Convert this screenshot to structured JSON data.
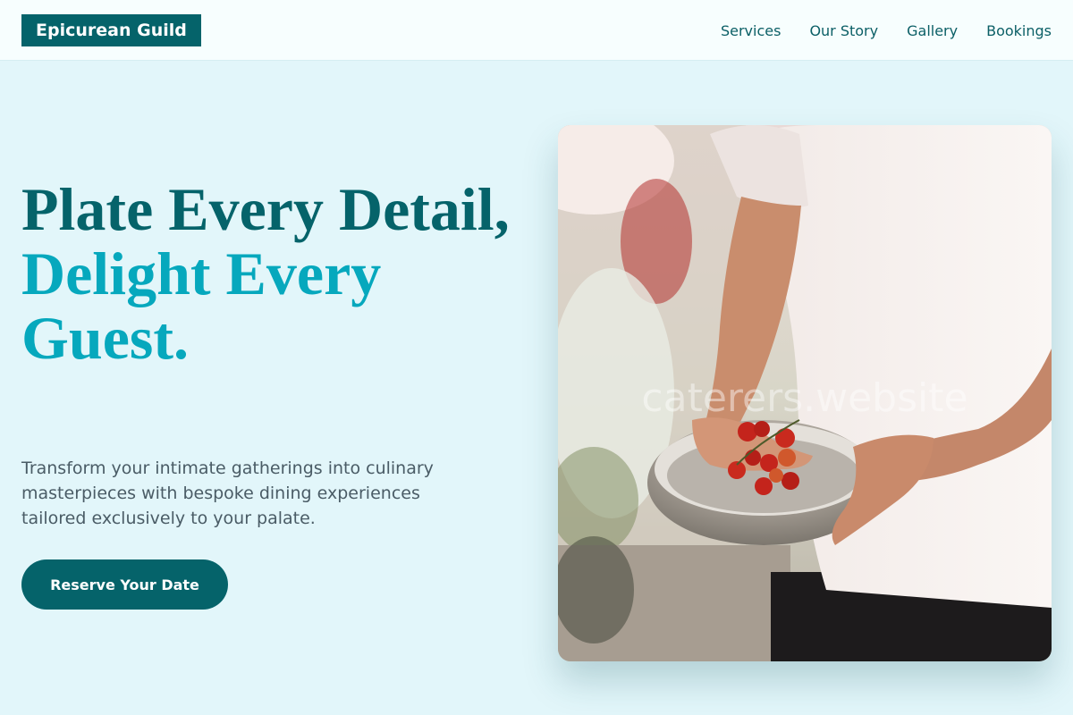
{
  "brand": {
    "name": "Epicurean Guild"
  },
  "nav": {
    "items": [
      {
        "label": "Services"
      },
      {
        "label": "Our Story"
      },
      {
        "label": "Gallery"
      },
      {
        "label": "Bookings"
      }
    ]
  },
  "hero": {
    "title_line1": "Plate Every Detail,",
    "title_line2": "Delight Every Guest.",
    "subtitle": "Transform your intimate gatherings into culinary masterpieces with bespoke dining experiences tailored exclusively to your palate.",
    "cta_label": "Reserve Your Date",
    "image_watermark": "caterers.website"
  },
  "colors": {
    "page_bg": "#e2f6fa",
    "header_bg": "#f7fefe",
    "brand_dark": "#05636a",
    "accent": "#06a8bd",
    "body_text": "#4a5c66"
  }
}
